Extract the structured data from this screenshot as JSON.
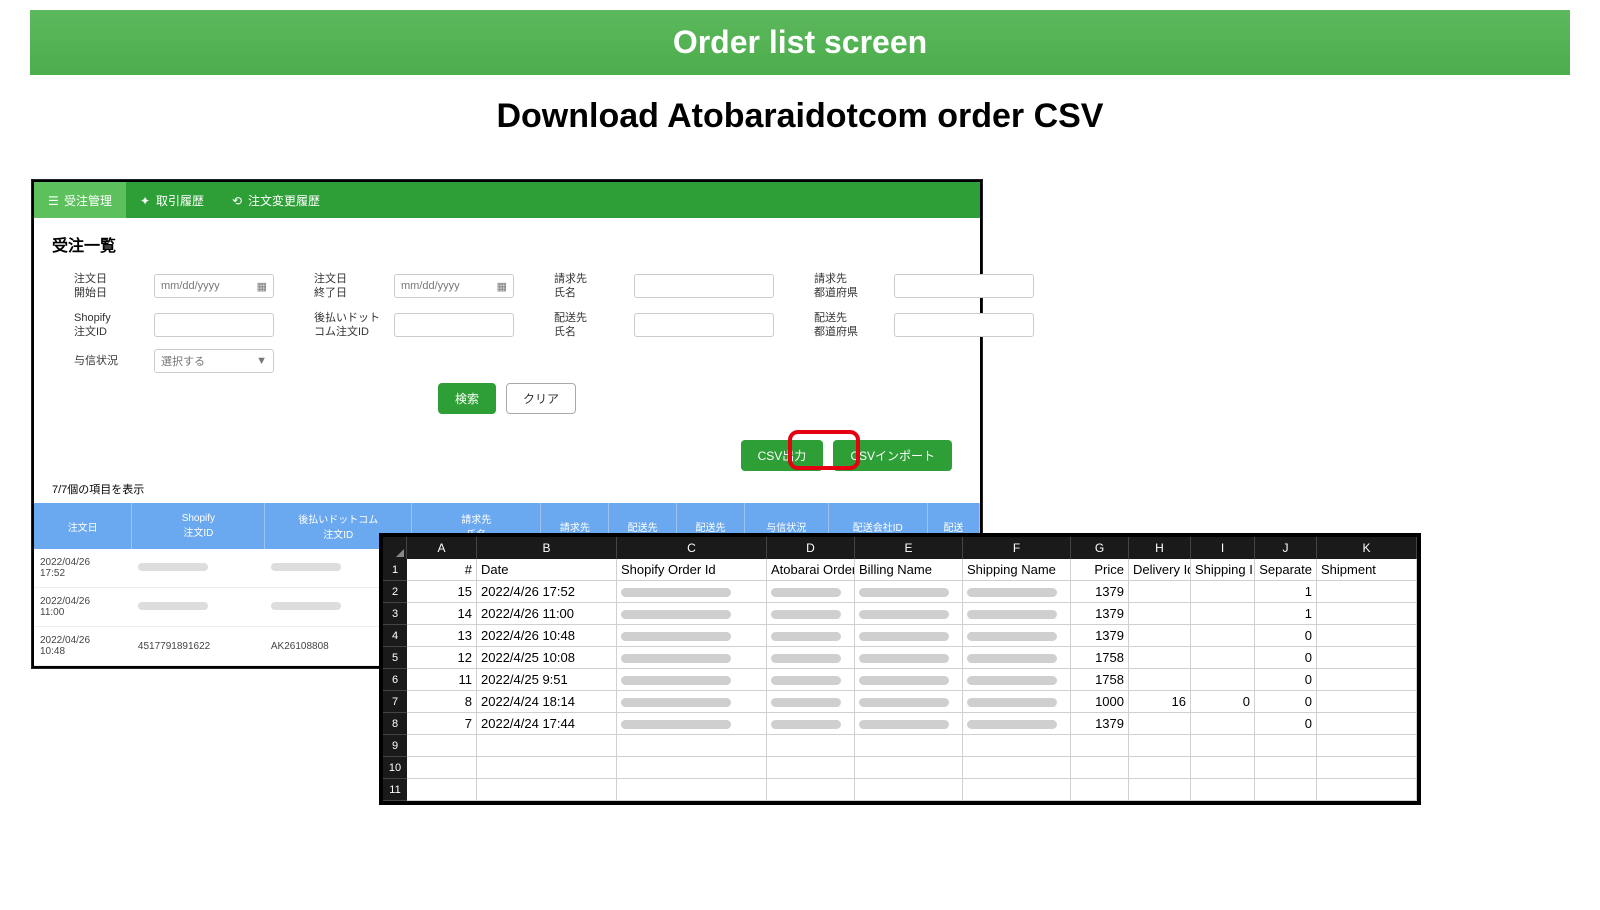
{
  "title_bar": "Order list screen",
  "subtitle": "Download Atobaraidotcom order CSV",
  "nav": {
    "items": [
      {
        "label": "受注管理",
        "icon": "list-icon",
        "active": true
      },
      {
        "label": "取引履歴",
        "icon": "chart-icon",
        "active": false
      },
      {
        "label": "注文変更履歴",
        "icon": "history-icon",
        "active": false
      }
    ]
  },
  "page_heading": "受注一覧",
  "filters": {
    "order_start_label": "注文日\n開始日",
    "order_start_placeholder": "mm/dd/yyyy",
    "order_end_label": "注文日\n終了日",
    "order_end_placeholder": "mm/dd/yyyy",
    "billing_name_label": "請求先\n氏名",
    "billing_pref_label": "請求先\n都道府県",
    "shopify_id_label": "Shopify\n注文ID",
    "atobarai_id_label": "後払いドット\nコム注文ID",
    "shipping_name_label": "配送先\n氏名",
    "shipping_pref_label": "配送先\n都道府県",
    "credit_status_label": "与信状況",
    "credit_status_value": "選択する"
  },
  "buttons": {
    "search": "検索",
    "clear": "クリア",
    "csv_export": "CSV出力",
    "csv_import": "CSVインポート"
  },
  "count_text": "7/7個の項目を表示",
  "table": {
    "headers": [
      "注文日",
      "Shopify\n注文ID",
      "後払いドットコム\n注文ID",
      "請求先\n氏名",
      "請求先",
      "配送先",
      "配送先",
      "与信状況",
      "配送会社ID",
      "配送"
    ],
    "rows": [
      {
        "date": "2022/04/26\n17:52",
        "shopify": "",
        "atobarai": "",
        "billing": ""
      },
      {
        "date": "2022/04/26\n11:00",
        "shopify": "",
        "atobarai": "",
        "billing": ""
      },
      {
        "date": "2022/04/26\n10:48",
        "shopify": "4517791891622",
        "atobarai": "AK26108808",
        "billing": ""
      }
    ]
  },
  "spreadsheet": {
    "cols": [
      "A",
      "B",
      "C",
      "D",
      "E",
      "F",
      "G",
      "H",
      "I",
      "J",
      "K"
    ],
    "header_row": [
      "#",
      "Date",
      "Shopify Order Id",
      "Atobarai Order",
      "Billing Name",
      "Shipping Name",
      "Price",
      "Delivery Id",
      "Shipping I",
      "Separate",
      "Shipment"
    ],
    "rows": [
      {
        "n": "15",
        "date": "2022/4/26 17:52",
        "price": "1379",
        "delivery": "",
        "shipping": "",
        "separate": "1"
      },
      {
        "n": "14",
        "date": "2022/4/26 11:00",
        "price": "1379",
        "delivery": "",
        "shipping": "",
        "separate": "1"
      },
      {
        "n": "13",
        "date": "2022/4/26 10:48",
        "price": "1379",
        "delivery": "",
        "shipping": "",
        "separate": "0"
      },
      {
        "n": "12",
        "date": "2022/4/25 10:08",
        "price": "1758",
        "delivery": "",
        "shipping": "",
        "separate": "0"
      },
      {
        "n": "11",
        "date": "2022/4/25 9:51",
        "price": "1758",
        "delivery": "",
        "shipping": "",
        "separate": "0"
      },
      {
        "n": "8",
        "date": "2022/4/24 18:14",
        "price": "1000",
        "delivery": "16",
        "shipping": "0",
        "separate": "0"
      },
      {
        "n": "7",
        "date": "2022/4/24 17:44",
        "price": "1379",
        "delivery": "",
        "shipping": "",
        "separate": "0"
      }
    ],
    "total_rows": 11
  }
}
